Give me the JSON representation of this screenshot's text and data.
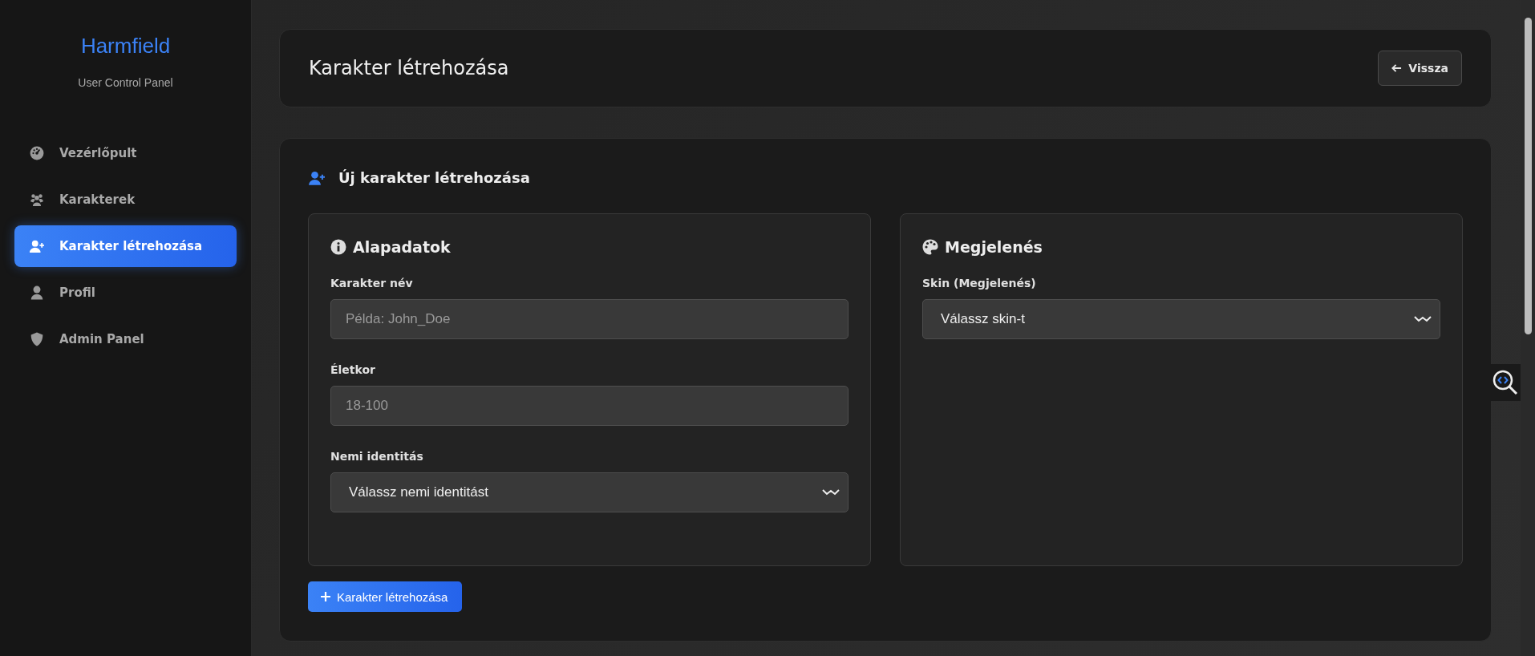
{
  "sidebar": {
    "brand": "Harmfield",
    "subtitle": "User Control Panel",
    "items": [
      {
        "label": "Vezérlőpult",
        "selected": false
      },
      {
        "label": "Karakterek",
        "selected": false
      },
      {
        "label": "Karakter létrehozása",
        "selected": true
      },
      {
        "label": "Profil",
        "selected": false
      },
      {
        "label": "Admin Panel",
        "selected": false
      }
    ]
  },
  "header": {
    "title": "Karakter létrehozása",
    "back_button": "Vissza"
  },
  "form": {
    "title": "Új karakter létrehozása",
    "sections": [
      {
        "title": "Alapadatok",
        "fields": [
          {
            "label": "Karakter név",
            "kind": "input",
            "placeholder": "Példa: John_Doe"
          },
          {
            "label": "Életkor",
            "kind": "input",
            "placeholder": "18-100"
          },
          {
            "label": "Nemi identitás",
            "kind": "select",
            "value": "Válassz nemi identitást"
          }
        ]
      },
      {
        "title": "Megjelenés",
        "fields": [
          {
            "label": "Skin (Megjelenés)",
            "kind": "select",
            "value": "Válassz skin-t"
          }
        ]
      }
    ],
    "submit": "Karakter létrehozása"
  }
}
